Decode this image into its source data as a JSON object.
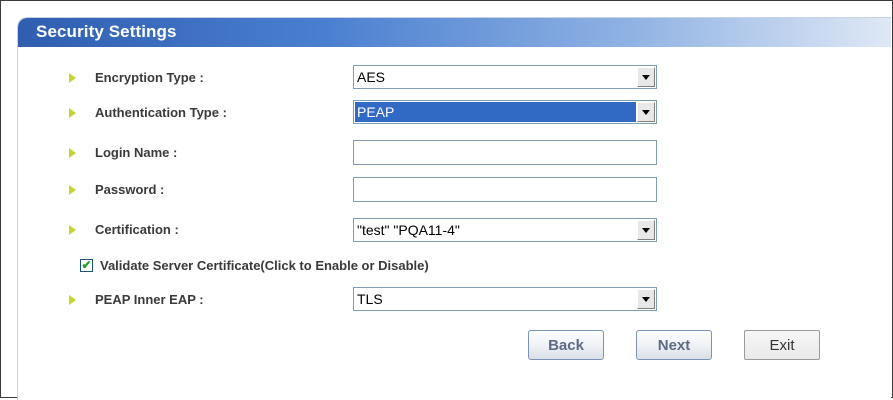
{
  "header": {
    "title": "Security Settings"
  },
  "fields": {
    "encryption_type": {
      "label": "Encryption Type :",
      "value": "AES"
    },
    "authentication_type": {
      "label": "Authentication Type :",
      "value": "PEAP"
    },
    "login_name": {
      "label": "Login Name :",
      "value": ""
    },
    "password": {
      "label": "Password :",
      "value": ""
    },
    "certification": {
      "label": "Certification :",
      "value": "\"test\" \"PQA11-4\""
    },
    "validate_cert": {
      "label": "Validate Server Certificate(Click to Enable or Disable)",
      "checked": true,
      "mark": "✔"
    },
    "peap_inner_eap": {
      "label": "PEAP Inner EAP :",
      "value": "TLS"
    }
  },
  "buttons": {
    "back": "Back",
    "next": "Next",
    "exit": "Exit"
  },
  "colors": {
    "header_start": "#2f5eb0",
    "header_end": "#dfe8f5",
    "arrow": "#c5d530",
    "selection": "#316ac5"
  }
}
